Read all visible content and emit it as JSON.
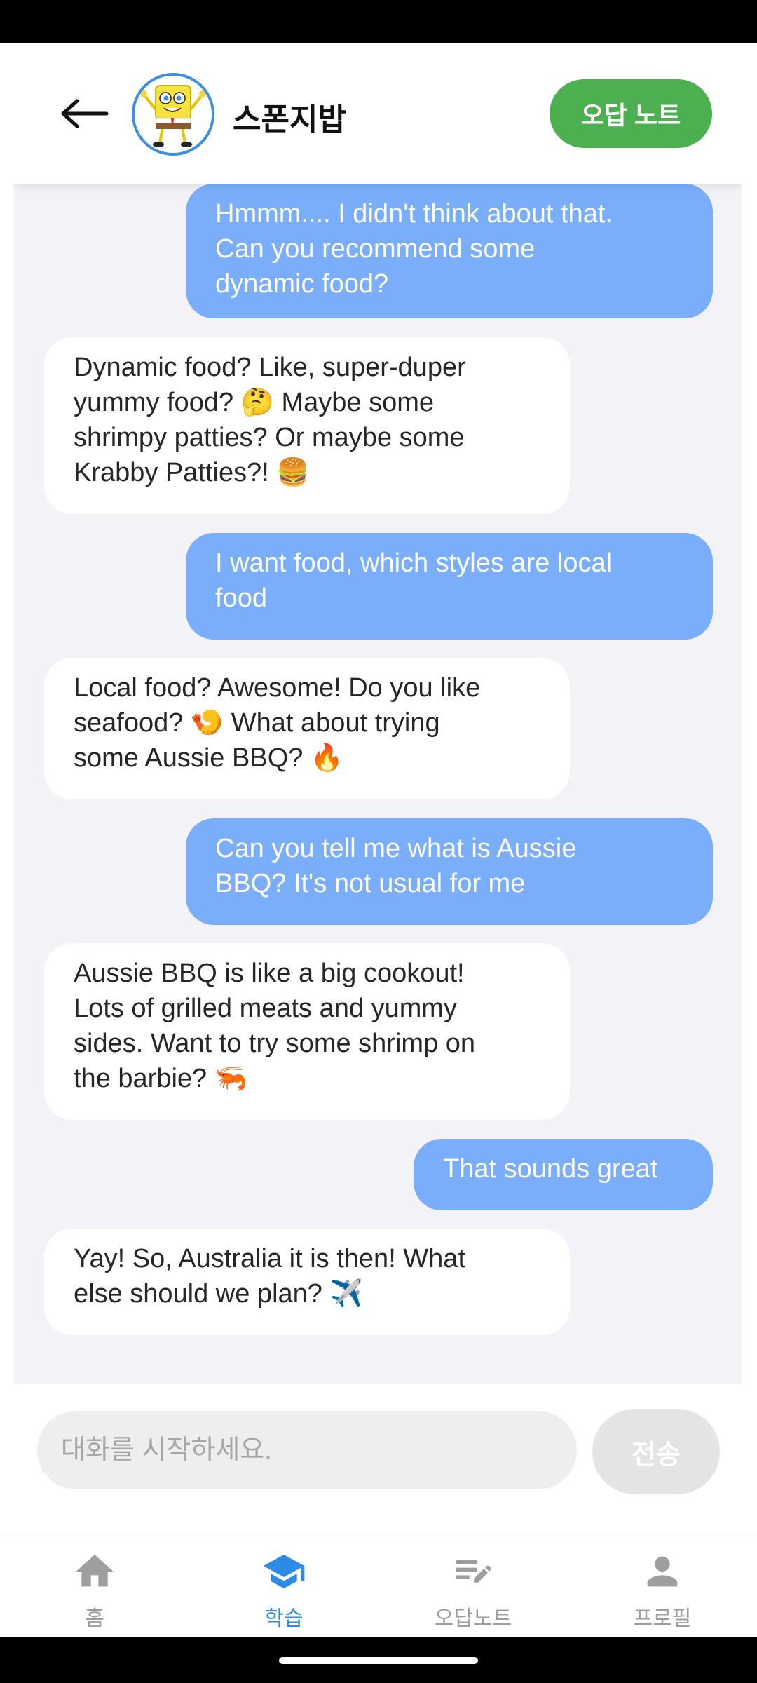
{
  "header": {
    "title": "스폰지밥",
    "note_button": "오답 노트",
    "back_icon": "arrow-left-icon",
    "avatar": "spongebob-avatar"
  },
  "messages": [
    {
      "role": "user",
      "text": "Hmmm.... I didn't think about that.\nCan you recommend some\ndynamic food?"
    },
    {
      "role": "bot",
      "text": "Dynamic food? Like, super-duper\nyummy food? 🤔 Maybe some\nshrimpy patties? Or maybe some\nKrabby Patties?! 🍔"
    },
    {
      "role": "user",
      "text": "I want food, which styles are local\nfood"
    },
    {
      "role": "bot",
      "text": "Local food? Awesome! Do you like\nseafood? 🍤 What about trying\nsome Aussie BBQ? 🔥"
    },
    {
      "role": "user",
      "text": "Can you tell me what is Aussie\nBBQ? It's not usual for me"
    },
    {
      "role": "bot",
      "text": "Aussie BBQ is like a big cookout!\nLots of grilled meats and yummy\nsides. Want to try some shrimp on\nthe barbie? 🦐"
    },
    {
      "role": "user",
      "text": "That sounds great"
    },
    {
      "role": "bot",
      "text": "Yay! So, Australia it is then! What\nelse should we plan? ✈️"
    }
  ],
  "composer": {
    "placeholder": "대화를 시작하세요.",
    "value": "",
    "send_label": "전송"
  },
  "nav": {
    "items": [
      {
        "label": "홈",
        "icon": "home-icon",
        "active": false
      },
      {
        "label": "학습",
        "icon": "graduation-cap-icon",
        "active": true
      },
      {
        "label": "오답노트",
        "icon": "edit-note-icon",
        "active": false
      },
      {
        "label": "프로필",
        "icon": "person-icon",
        "active": false
      }
    ]
  },
  "colors": {
    "user_bubble": "#7aaefa",
    "bot_bubble": "#ffffff",
    "accent_green": "#4caf50",
    "nav_active": "#2c8be6",
    "chat_background": "#f2f2f7"
  }
}
